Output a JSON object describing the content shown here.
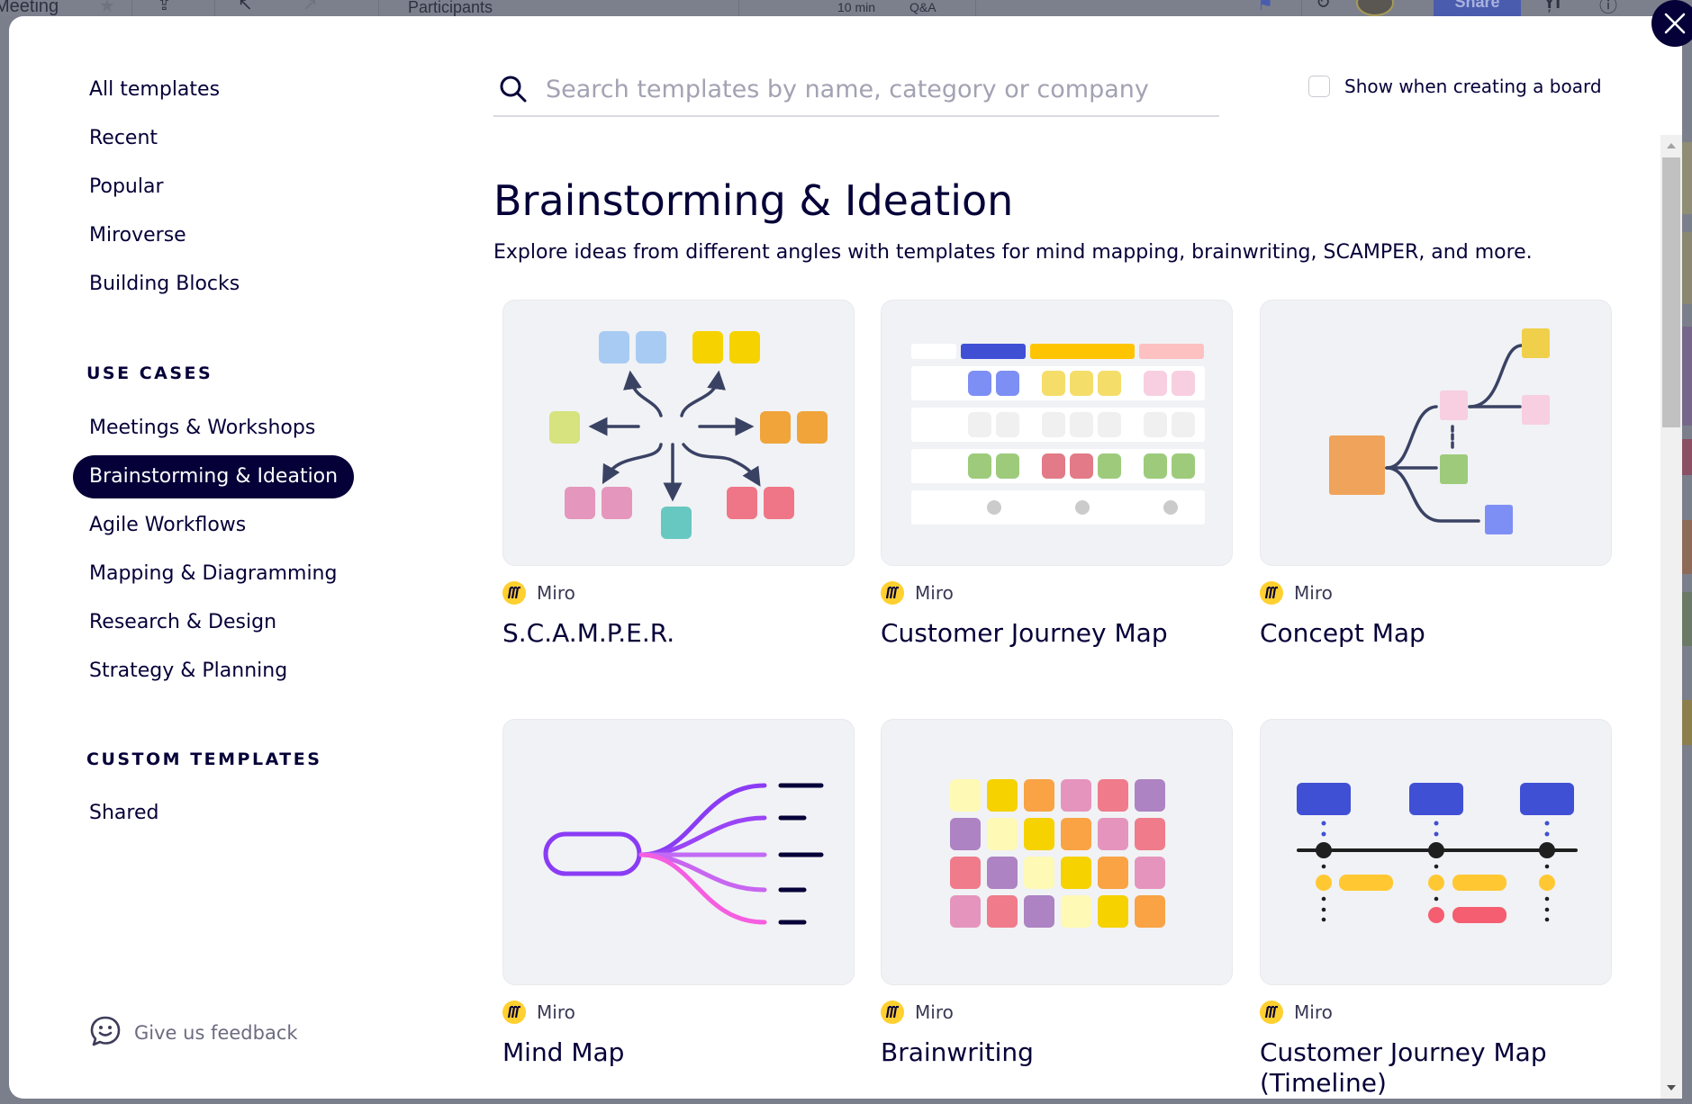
{
  "background_app": {
    "board_title": "Meeting",
    "participants_label": "Participants",
    "timer_label": "10 min",
    "qa_label": "Q&A",
    "share_label": "Share"
  },
  "modal": {
    "close_label": "Close"
  },
  "sidebar": {
    "top_items": [
      {
        "label": "All templates"
      },
      {
        "label": "Recent"
      },
      {
        "label": "Popular"
      },
      {
        "label": "Miroverse"
      },
      {
        "label": "Building Blocks"
      }
    ],
    "use_cases_heading": "USE CASES",
    "use_cases": [
      {
        "label": "Meetings & Workshops",
        "active": false
      },
      {
        "label": "Brainstorming & Ideation",
        "active": true
      },
      {
        "label": "Agile Workflows",
        "active": false
      },
      {
        "label": "Mapping & Diagramming",
        "active": false
      },
      {
        "label": "Research & Design",
        "active": false
      },
      {
        "label": "Strategy & Planning",
        "active": false
      }
    ],
    "custom_heading": "CUSTOM TEMPLATES",
    "custom_items": [
      {
        "label": "Shared"
      }
    ],
    "feedback_label": "Give us feedback"
  },
  "search": {
    "placeholder": "Search templates by name, category or company",
    "value": ""
  },
  "show_when_creating": {
    "label": "Show when creating a board",
    "checked": false
  },
  "category": {
    "title": "Brainstorming & Ideation",
    "description": "Explore ideas from different angles with templates for mind mapping, brainwriting, SCAMPER, and more."
  },
  "templates": [
    {
      "title": "S.C.A.M.P.E.R.",
      "author": "Miro",
      "thumbnail": "scamper"
    },
    {
      "title": "Customer Journey Map",
      "author": "Miro",
      "thumbnail": "customer-journey-map"
    },
    {
      "title": "Concept Map",
      "author": "Miro",
      "thumbnail": "concept-map"
    },
    {
      "title": "Mind Map",
      "author": "Miro",
      "thumbnail": "mind-map"
    },
    {
      "title": "Brainwriting",
      "author": "Miro",
      "thumbnail": "brainwriting"
    },
    {
      "title": "Customer Journey Map (Timeline)",
      "author": "Miro",
      "thumbnail": "customer-journey-timeline"
    }
  ],
  "colors": {
    "brand_dark": "#050038",
    "miro_yellow": "#ffd02f",
    "thumb_bg": "#f1f2f5"
  }
}
